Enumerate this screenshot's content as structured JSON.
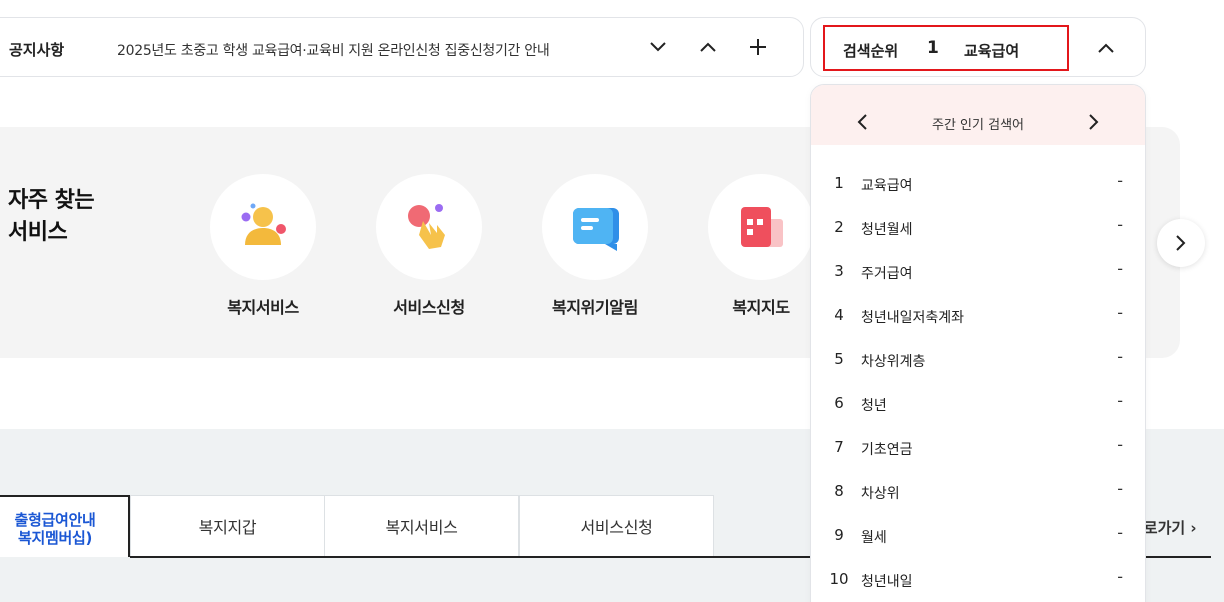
{
  "notice": {
    "label": "공지사항",
    "text": "2025년도 초중고 학생 교육급여·교육비 지원 온라인신청 집중신청기간 안내"
  },
  "search_rank": {
    "label": "검색순위",
    "current_rank": "1",
    "current_term": "교육급여",
    "highlight_color": "#e3171b"
  },
  "popular": {
    "title": "주간 인기 검색어",
    "items": [
      {
        "rank": "1",
        "term": "교육급여",
        "change": "-"
      },
      {
        "rank": "2",
        "term": "청년월세",
        "change": "-"
      },
      {
        "rank": "3",
        "term": "주거급여",
        "change": "-"
      },
      {
        "rank": "4",
        "term": "청년내일저축계좌",
        "change": "-"
      },
      {
        "rank": "5",
        "term": "차상위계층",
        "change": "-"
      },
      {
        "rank": "6",
        "term": "청년",
        "change": "-"
      },
      {
        "rank": "7",
        "term": "기초연금",
        "change": "-"
      },
      {
        "rank": "8",
        "term": "차상위",
        "change": "-"
      },
      {
        "rank": "9",
        "term": "월세",
        "change": "-"
      },
      {
        "rank": "10",
        "term": "청년내일",
        "change": "-"
      }
    ]
  },
  "services": {
    "title_line1": "자주 찾는",
    "title_line2": "서비스",
    "items": [
      {
        "label": "복지서비스",
        "icon": "people-icon"
      },
      {
        "label": "서비스신청",
        "icon": "hand-tap-icon"
      },
      {
        "label": "복지위기알림",
        "icon": "chat-bubble-icon"
      },
      {
        "label": "복지지도",
        "icon": "map-grid-icon"
      }
    ]
  },
  "tabs": {
    "active_line1": "출형급여안내",
    "active_line2": "복지멤버십)",
    "items": [
      "복지지갑",
      "복지서비스",
      "서비스신청"
    ],
    "shortcut": "바로가기 ›",
    "accent": "#1b57d4"
  }
}
